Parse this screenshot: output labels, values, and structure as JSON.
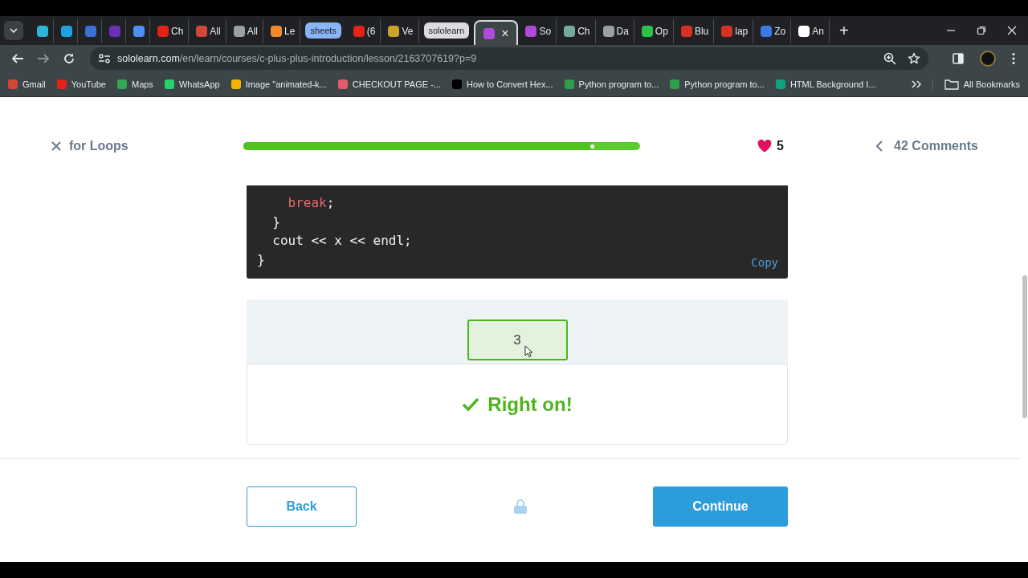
{
  "browser": {
    "tabs": [
      {
        "kind": "icon",
        "color": "#2bb5d9",
        "selected": false
      },
      {
        "kind": "icon",
        "color": "#1fa3e0",
        "selected": false
      },
      {
        "kind": "icon",
        "color": "#3b6fd6",
        "selected": false
      },
      {
        "kind": "icon",
        "color": "#6a2fb5",
        "selected": false
      },
      {
        "kind": "icon",
        "color": "#4d8ef7",
        "selected": false
      },
      {
        "kind": "tab",
        "color": "#e62117",
        "label": "Ch",
        "selected": false
      },
      {
        "kind": "tab",
        "color": "#d44638",
        "label": "All",
        "selected": false
      },
      {
        "kind": "tab",
        "color": "#9aa0a6",
        "label": "All",
        "selected": false
      },
      {
        "kind": "tab",
        "color": "#f28b30",
        "label": "Le",
        "selected": false
      },
      {
        "kind": "group",
        "label": "sheets",
        "color": "#8ab4f8"
      },
      {
        "kind": "tab",
        "color": "#e62117",
        "label": "(6",
        "selected": false
      },
      {
        "kind": "tab",
        "color": "#c9a227",
        "label": "Ve",
        "selected": false
      },
      {
        "kind": "group",
        "label": "sololearn",
        "color": "#dadce0"
      },
      {
        "kind": "tab",
        "color": "#b04ad9",
        "selected": true,
        "close": "×"
      },
      {
        "kind": "tab",
        "color": "#b04ad9",
        "label": "So",
        "selected": false
      },
      {
        "kind": "tab",
        "color": "#74aa9c",
        "label": "Ch",
        "selected": false
      },
      {
        "kind": "tab",
        "color": "#9aa0a6",
        "label": "Da",
        "selected": false
      },
      {
        "kind": "tab",
        "color": "#2bc14a",
        "label": "Op",
        "selected": false
      },
      {
        "kind": "tab",
        "color": "#d93025",
        "label": "Blu",
        "selected": false
      },
      {
        "kind": "tab",
        "color": "#d93025",
        "label": "lap",
        "selected": false
      },
      {
        "kind": "tab",
        "color": "#3d7ae0",
        "label": "Zo",
        "selected": false
      },
      {
        "kind": "tab",
        "color": "#ffffff",
        "label": "An",
        "selected": false
      }
    ],
    "new_tab": "+",
    "address": {
      "domain": "sololearn.com",
      "path": "/en/learn/courses/c-plus-plus-introduction/lesson/2163707619?p=9"
    },
    "bookmarks": [
      {
        "label": "Gmail",
        "color": "#d44638"
      },
      {
        "label": "YouTube",
        "color": "#e62117"
      },
      {
        "label": "Maps",
        "color": "#34a853"
      },
      {
        "label": "WhatsApp",
        "color": "#25d366"
      },
      {
        "label": "Image \"animated-k...",
        "color": "#f5b400"
      },
      {
        "label": "CHECKOUT PAGE -...",
        "color": "#e35d6a"
      },
      {
        "label": "How to Convert Hex...",
        "color": "#000000"
      },
      {
        "label": "Python program to...",
        "color": "#2e9e4a"
      },
      {
        "label": "Python program to...",
        "color": "#2e9e4a"
      },
      {
        "label": "HTML Background I...",
        "color": "#0fa37f"
      }
    ],
    "all_bookmarks": "All Bookmarks"
  },
  "lesson": {
    "title": "for Loops",
    "progress": {
      "level": 0.88
    },
    "hearts": "5",
    "comments": "42 Comments"
  },
  "code": {
    "lines": [
      [
        {
          "kind": "keyword",
          "text": "    break"
        },
        {
          "kind": "plain",
          "text": ";"
        }
      ],
      [
        {
          "kind": "plain",
          "text": "  }"
        }
      ],
      [
        {
          "kind": "plain",
          "text": "  cout << x << endl;"
        }
      ],
      [
        {
          "kind": "plain",
          "text": "}"
        }
      ]
    ],
    "copy": "Copy"
  },
  "answer": {
    "value": "3",
    "correct": true
  },
  "feedback": {
    "text": "Right on!",
    "correct": true
  },
  "buttons": {
    "back": "Back",
    "continue": "Continue",
    "locked": true
  }
}
